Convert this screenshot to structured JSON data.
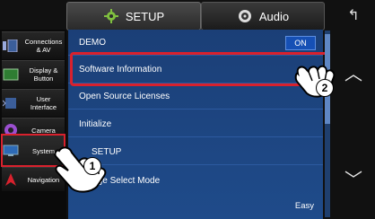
{
  "tabs": {
    "setup": "SETUP",
    "audio": "Audio"
  },
  "sidebar": {
    "items": [
      {
        "label": "Connections & AV",
        "icon": "connections-icon"
      },
      {
        "label": "Display & Button",
        "icon": "display-icon"
      },
      {
        "label": "User Interface",
        "icon": "user-interface-icon"
      },
      {
        "label": "Camera",
        "icon": "camera-icon"
      },
      {
        "label": "System",
        "icon": "system-icon",
        "selected": true
      },
      {
        "label": "Navigation",
        "icon": "navigation-icon"
      }
    ]
  },
  "list": {
    "rows": [
      {
        "label": "DEMO",
        "value": "ON"
      },
      {
        "label": "Software Information"
      },
      {
        "label": "Open Source Licenses"
      },
      {
        "label": "Initialize"
      },
      {
        "label": "SETUP"
      },
      {
        "label": "guage Select Mode",
        "value": "Easy"
      }
    ]
  },
  "callouts": {
    "one": "1",
    "two": "2"
  },
  "colors": {
    "highlight": "#d9212d",
    "list_bg": "#1f4b8a",
    "on_badge": "#1650b5"
  }
}
